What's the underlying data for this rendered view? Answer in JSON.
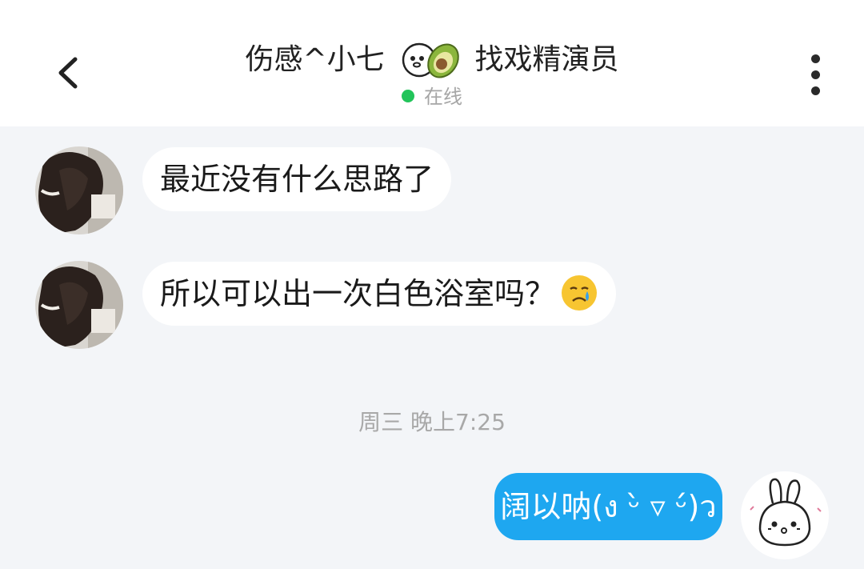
{
  "header": {
    "title_left": "伤感^小七",
    "title_right": "找戏精演员",
    "status": "在线",
    "back_icon": "chevron-left-icon",
    "more_icon": "more-vertical-icon"
  },
  "messages": [
    {
      "side": "incoming",
      "text": "最近没有什么思路了"
    },
    {
      "side": "incoming",
      "text": "所以可以出一次白色浴室吗？",
      "emoji": "crying-face-emoji"
    }
  ],
  "timestamp": "周三 晚上7:25",
  "outgoing": {
    "text": "阔以呐(ง ᵕ̀ ▿ ᵕ́)ว"
  },
  "colors": {
    "bubble_out": "#1ea7f0",
    "online_dot": "#22c45a",
    "background": "#f3f5f8"
  }
}
